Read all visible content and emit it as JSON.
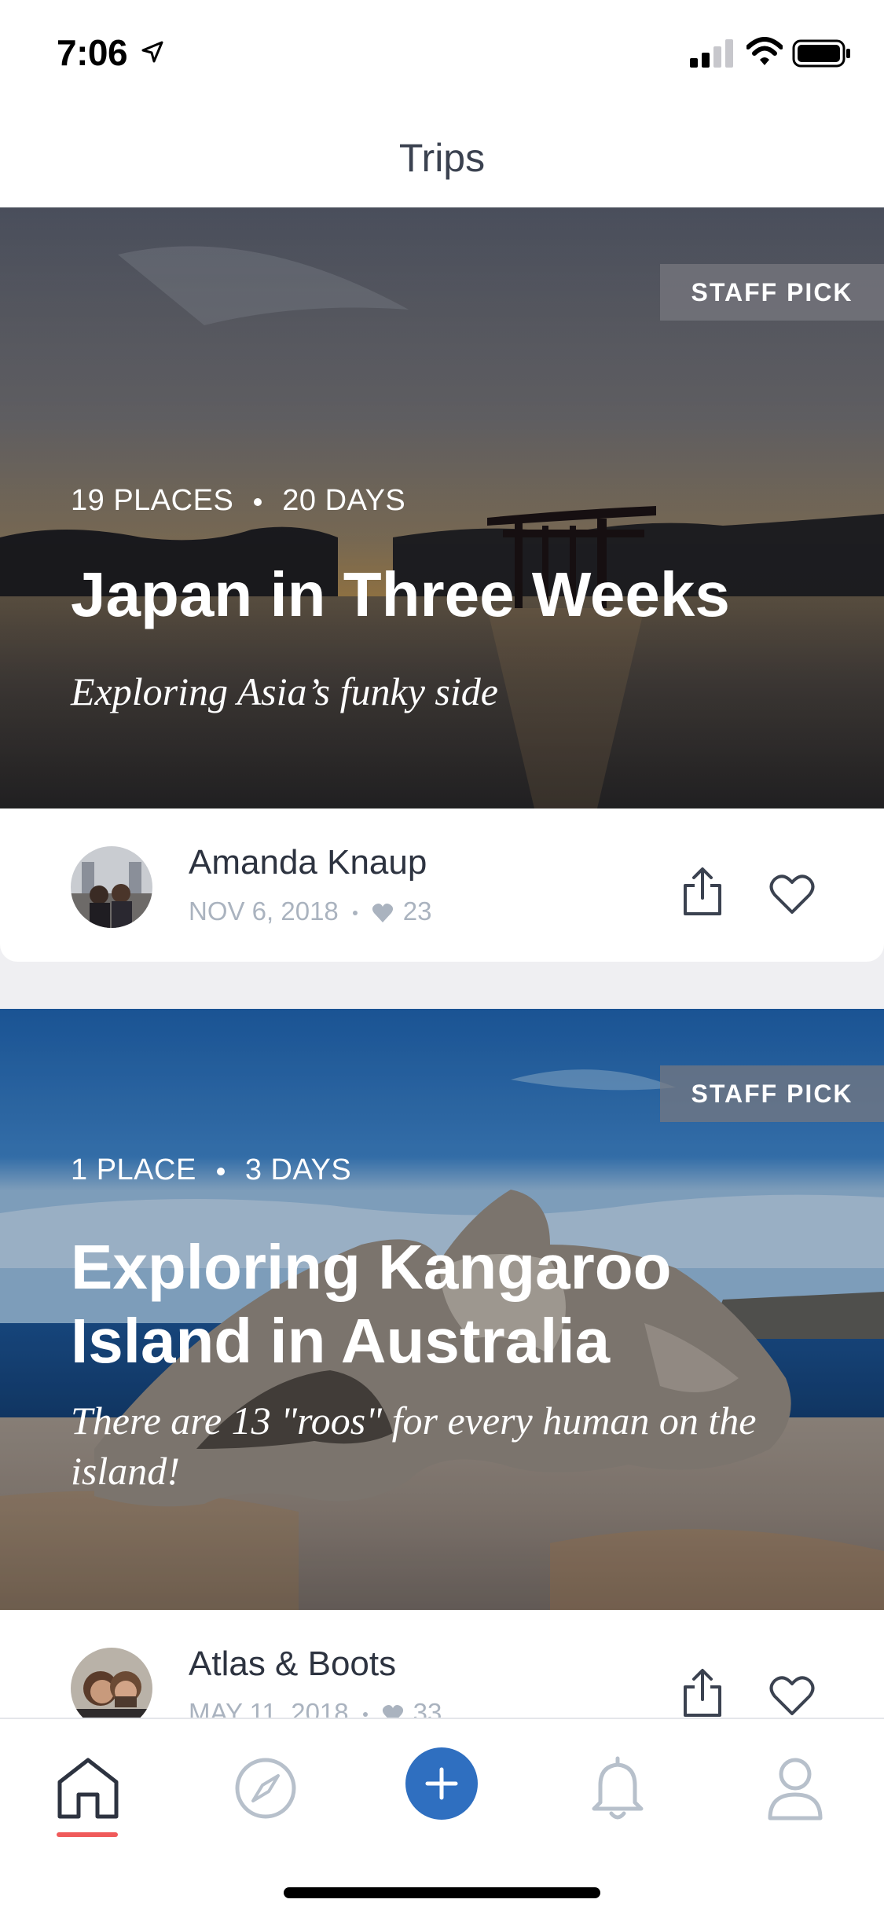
{
  "status_bar": {
    "time": "7:06"
  },
  "header": {
    "title": "Trips"
  },
  "trips": [
    {
      "badge": "STAFF PICK",
      "places": "19 PLACES",
      "days": "20 DAYS",
      "title": "Japan in Three Weeks",
      "subtitle": "Exploring Asia’s funky side",
      "author": "Amanda Knaup",
      "date": "NOV 6, 2018",
      "likes": "23"
    },
    {
      "badge": "STAFF PICK",
      "places": "1 PLACE",
      "days": "3 DAYS",
      "title": "Exploring Kangaroo Island in Australia",
      "subtitle": "There are 13 \"roos\" for every human on the island!",
      "author": "Atlas & Boots",
      "date": "MAY 11, 2018",
      "likes": "33"
    }
  ],
  "tab_bar": {
    "items": [
      {
        "icon": "home-icon",
        "selected": true
      },
      {
        "icon": "compass-icon",
        "selected": false
      },
      {
        "icon": "plus-icon",
        "selected": false
      },
      {
        "icon": "bell-icon",
        "selected": false
      },
      {
        "icon": "profile-icon",
        "selected": false
      }
    ],
    "active_color": "#f05a5a",
    "add_color": "#2f6fc0"
  }
}
